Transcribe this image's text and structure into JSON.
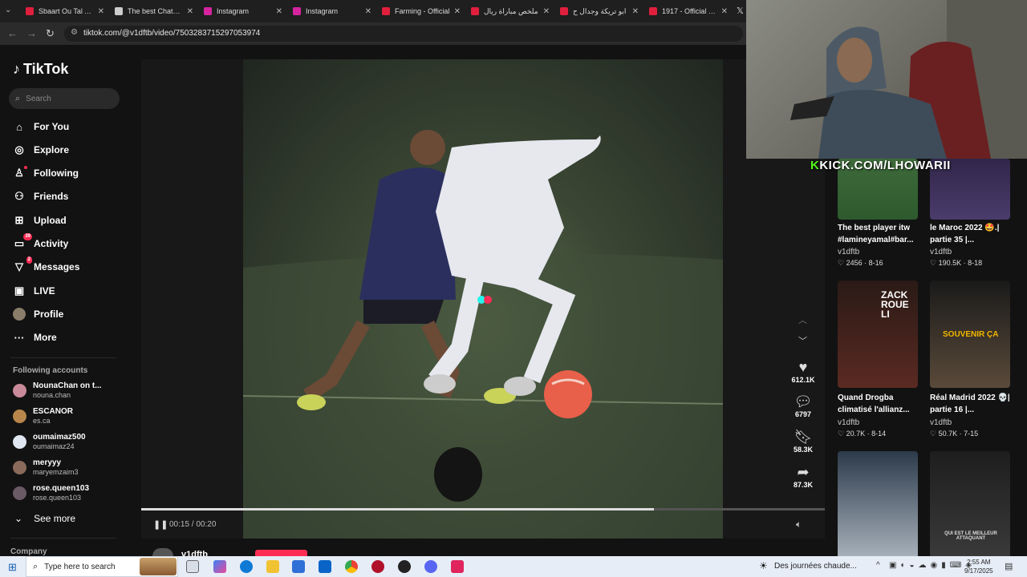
{
  "tabs": [
    {
      "title": "Sbaart Ou Tal Adı",
      "color": "#e01f3d"
    },
    {
      "title": "The best ChatBot",
      "color": "#cccccc"
    },
    {
      "title": "Instagram",
      "color": "#d6249f"
    },
    {
      "title": "Instagram",
      "color": "#d6249f"
    },
    {
      "title": "Farming - Official",
      "color": "#e01f3d"
    },
    {
      "title": "ملخص مباراة ريال",
      "color": "#e01f3d"
    },
    {
      "title": "ابو تريكة وجدال ح",
      "color": "#e01f3d"
    },
    {
      "title": "1917 - Official Tra",
      "color": "#e01f3d"
    }
  ],
  "address": {
    "url": "tiktok.com/@v1dftb/video/7503283715297053974"
  },
  "sidebar": {
    "logo": "TikTok",
    "search_placeholder": "Search",
    "nav": [
      {
        "label": "For You",
        "icon": "home-icon",
        "glyph": "⌂"
      },
      {
        "label": "Explore",
        "icon": "compass-icon",
        "glyph": "◎"
      },
      {
        "label": "Following",
        "icon": "following-icon",
        "glyph": "♙"
      },
      {
        "label": "Friends",
        "icon": "friends-icon",
        "glyph": "⚇"
      },
      {
        "label": "Upload",
        "icon": "upload-icon",
        "glyph": "⊞"
      },
      {
        "label": "Activity",
        "icon": "activity-icon",
        "glyph": "▭",
        "badge": "39"
      },
      {
        "label": "Messages",
        "icon": "messages-icon",
        "glyph": "▽",
        "badge": "2"
      },
      {
        "label": "LIVE",
        "icon": "live-icon",
        "glyph": "▣"
      },
      {
        "label": "Profile",
        "icon": "profile-icon",
        "glyph": "●"
      },
      {
        "label": "More",
        "icon": "more-icon",
        "glyph": "···"
      }
    ],
    "following_heading": "Following accounts",
    "accounts": [
      {
        "name": "NounaChan on t...",
        "handle": "nouna.chan",
        "color": "#c98a9a"
      },
      {
        "name": "ESCANOR",
        "handle": "es.ca",
        "color": "#b8864b"
      },
      {
        "name": "oumaimaz500",
        "handle": "oumaimaz24",
        "color": "#dfe6f0"
      },
      {
        "name": "meryyy",
        "handle": "maryemzaim3",
        "color": "#8a6a5a"
      },
      {
        "name": "rose.queen103",
        "handle": "rose.queen103",
        "color": "#6a5a66"
      }
    ],
    "see_more": "See more",
    "company": "Company"
  },
  "player": {
    "time": "00:15 / 00:20",
    "progress": 0.75,
    "author": "v1dftb"
  },
  "actions": [
    {
      "icon": "heart-icon",
      "glyph": "♥",
      "count": "612.1K"
    },
    {
      "icon": "comment-icon",
      "glyph": "●",
      "count": "6797"
    },
    {
      "icon": "bookmark-icon",
      "glyph": "▮",
      "count": "58.3K"
    },
    {
      "icon": "share-icon",
      "glyph": "➦",
      "count": "87.3K"
    }
  ],
  "overlay": {
    "kick": "KICK.COM/LHOWARII",
    "kick_prefix": "K"
  },
  "related": [
    {
      "title": "The best player itw #lamineyamal#bar...",
      "author": "v1dftb",
      "likes": "2456",
      "date": "8-16"
    },
    {
      "title": "le Maroc 2022 🤩.| partie 35 |...",
      "author": "v1dftb",
      "likes": "190.5K",
      "date": "8-18"
    },
    {
      "title": "Quand Drogba climatisé l'allianz...",
      "author": "v1dftb",
      "likes": "20.7K",
      "date": "8-14",
      "thumb_text": "ZACK ROUE LI"
    },
    {
      "title": "Réal Madrid 2022 💀| partie 16 |...",
      "author": "v1dftb",
      "likes": "50.7K",
      "date": "7-15",
      "thumb_text": "SOUVENIR ÇA"
    },
    {
      "thumb_text": ""
    },
    {
      "thumb_text": "QUI EST LE MEILLEUR ATTAQUANT"
    }
  ],
  "taskbar": {
    "search_placeholder": "Type here to search",
    "weather": "Des journées chaude...",
    "time": "2:55 AM",
    "date": "9/17/2025"
  }
}
